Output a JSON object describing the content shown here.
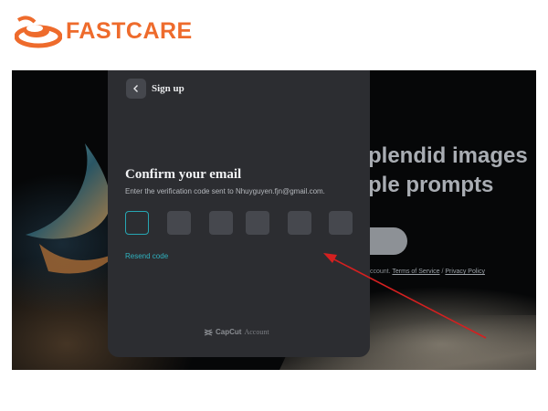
{
  "logo": {
    "text": "FASTCARE",
    "color": "#ee6b2c"
  },
  "background": {
    "hero_line1": "plendid images",
    "hero_line2": "ple prompts",
    "legal_prefix": "ccount.",
    "terms_link": "Terms of Service",
    "separator": "/",
    "privacy_link": "Privacy Policy"
  },
  "modal": {
    "back_icon": "chevron-left-icon",
    "title": "Sign up",
    "heading": "Confirm your email",
    "description": "Enter the verification code sent to Nhuyguyen.fjn@gmail.com.",
    "code_boxes": [
      "",
      "",
      "",
      "",
      "",
      ""
    ],
    "resend_label": "Resend code",
    "footer_brand": "CapCut",
    "footer_account": "Account"
  },
  "annotation": {
    "color": "#d42020",
    "icon": "red-arrow"
  },
  "colors": {
    "modal_bg": "#2c2d31",
    "accent": "#2fb2bf"
  }
}
